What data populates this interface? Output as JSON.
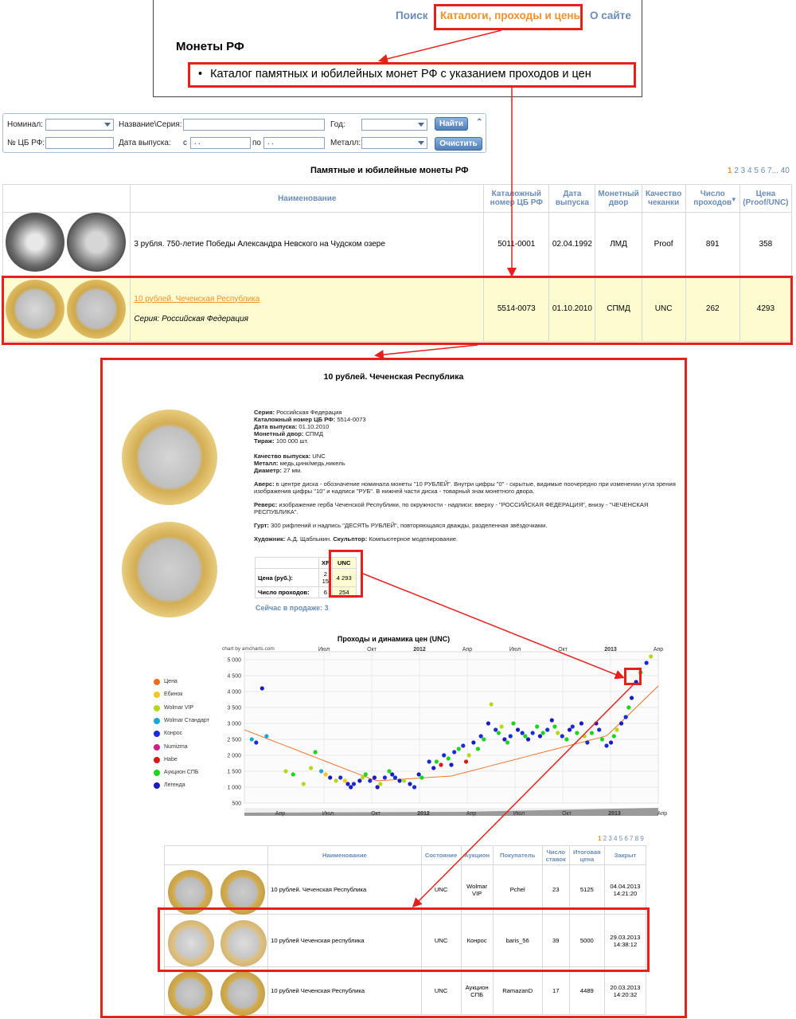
{
  "nav": {
    "search": "Поиск",
    "catalogs": "Каталоги, проходы и цены",
    "about": "О сайте",
    "section_title": "Монеты РФ",
    "catalog_link": "Каталог памятных и юбилейных монет РФ с указанием проходов и цен"
  },
  "filters": {
    "nominal_label": "Номинал:",
    "name_label": "Название\\Серия:",
    "year_label": "Год:",
    "cbr_label": "№ ЦБ РФ:",
    "date_label": "Дата выпуска:",
    "from_label": "с",
    "to_label": "по",
    "metal_label": "Металл:",
    "date_placeholder": " .  .    ",
    "find_button": "Найти",
    "clear_button": "Очистить"
  },
  "list": {
    "title": "Памятные и юбилейные монеты РФ",
    "pager_current": "1",
    "pager_rest": "2 3 4 5 6 7...",
    "pager_last": "40",
    "headers": {
      "name": "Наименование",
      "catalog": "Каталожный номер ЦБ РФ",
      "date": "Дата выпуска",
      "mint": "Монетный двор",
      "quality": "Качество чеканки",
      "passes": "Число проходов",
      "price": "Цена (Proof/UNC)"
    },
    "rows": [
      {
        "name": "3 рубля. 750-летие Победы Александра Невского на Чудском озере",
        "series": "",
        "catalog": "5011-0001",
        "date": "02.04.1992",
        "mint": "ЛМД",
        "quality": "Proof",
        "passes": "891",
        "price": "358"
      },
      {
        "name": "10 рублей. Чеченская Республика",
        "series": "Серия: Российская Федерация",
        "catalog": "5514-0073",
        "date": "01.10.2010",
        "mint": "СПМД",
        "quality": "UNC",
        "passes": "262",
        "price": "4293"
      }
    ]
  },
  "detail": {
    "title": "10 рублей. Чеченская Республика",
    "series_label": "Серия:",
    "series": "Российская Федерация",
    "catalog_label": "Каталожный номер ЦБ РФ:",
    "catalog": "5514-0073",
    "date_label": "Дата выпуска:",
    "date": "01.10.2010",
    "mint_label": "Монетный двор:",
    "mint": "СПМД",
    "mintage_label": "Тираж:",
    "mintage": "100 000 шт.",
    "quality_label": "Качество выпуска:",
    "quality": "UNC",
    "metal_label": "Металл:",
    "metal": "медь,цинк/медь,никель",
    "diameter_label": "Диаметр:",
    "diameter": "27 мм.",
    "obverse_label": "Аверс:",
    "obverse": "в центре диска - обозначение номинала монеты \"10 РУБЛЕЙ\". Внутри цифры \"0\" - скрытые, видимые поочередно при изменении угла зрения изображения цифры \"10\" и надписи \"РУБ\". В нижней части диска - товарный знак монетного двора.",
    "reverse_label": "Реверс:",
    "reverse": "изображение герба Чеченской Республики, по окружности - надписи: вверху - \"РОССИЙСКАЯ ФЕДЕРАЦИЯ\", внизу - \"ЧЕЧЕНСКАЯ РЕСПУБЛИКА\".",
    "edge_label": "Гурт:",
    "edge": "300 рифлений и надпись \"ДЕСЯТЬ РУБЛЕЙ\", повторяющаяся дважды, разделенная звёздочками.",
    "artist_label": "Художник:",
    "artist": "А.Д. Щаблыкин.",
    "sculptor_label": "Скульптор:",
    "sculptor": "Компьютерное моделирование.",
    "price_table": {
      "col_xf": "XF",
      "col_unc": "UNC",
      "price_label": "Цена (руб.):",
      "price_xf": "2 15",
      "price_unc": "4 293",
      "passes_label": "Число проходов:",
      "passes_xf": "6",
      "passes_unc": "254"
    },
    "on_sale": "Сейчас в продаже: 3"
  },
  "chart_data": {
    "type": "scatter",
    "title": "Проходы и динамика цен (UNC)",
    "credit": "chart by amcharts.com",
    "x_ticks": [
      "Июл",
      "Окт",
      "2012",
      "Апр",
      "Июл",
      "Окт",
      "2013",
      "Апр"
    ],
    "scroll_ticks": [
      "Апр",
      "Июл",
      "Окт",
      "2012",
      "Апр",
      "Июл",
      "Окт",
      "2013",
      "Апр"
    ],
    "y_ticks": [
      "5 000",
      "4 500",
      "4 000",
      "3 500",
      "3 000",
      "2 500",
      "2 000",
      "1 500",
      "1 000",
      "500"
    ],
    "ylim": [
      500,
      5000
    ],
    "series": [
      {
        "name": "Цена",
        "color": "#f26a1b"
      },
      {
        "name": "Ебинок",
        "color": "#f2c81b"
      },
      {
        "name": "Wolmar VIP",
        "color": "#b9d61b"
      },
      {
        "name": "Wolmar Стандарт",
        "color": "#1ba6d6"
      },
      {
        "name": "Конрос",
        "color": "#1b2cd6"
      },
      {
        "name": "Numizma",
        "color": "#d61b8a"
      },
      {
        "name": "Habe",
        "color": "#d61b1b"
      },
      {
        "name": "Аукцион СПБ",
        "color": "#1bd61b"
      },
      {
        "name": "Легенда",
        "color": "#1b1bbf"
      }
    ],
    "points": [
      [
        0.05,
        2500,
        3
      ],
      [
        0.08,
        2400,
        4
      ],
      [
        0.12,
        4100,
        8
      ],
      [
        0.15,
        2600,
        3
      ],
      [
        0.28,
        1500,
        2
      ],
      [
        0.33,
        1400,
        7
      ],
      [
        0.4,
        1100,
        2
      ],
      [
        0.45,
        1600,
        2
      ],
      [
        0.48,
        2100,
        7
      ],
      [
        0.52,
        1500,
        3
      ],
      [
        0.55,
        1400,
        1
      ],
      [
        0.58,
        1300,
        8
      ],
      [
        0.62,
        1200,
        2
      ],
      [
        0.65,
        1300,
        4
      ],
      [
        0.68,
        1200,
        1
      ],
      [
        0.7,
        1100,
        8
      ],
      [
        0.72,
        1000,
        8
      ],
      [
        0.74,
        1100,
        4
      ],
      [
        0.78,
        1200,
        8
      ],
      [
        0.8,
        1300,
        2
      ],
      [
        0.82,
        1400,
        7
      ],
      [
        0.85,
        1200,
        4
      ],
      [
        0.88,
        1300,
        8
      ],
      [
        0.9,
        1000,
        8
      ],
      [
        0.92,
        1100,
        2
      ],
      [
        0.95,
        1300,
        4
      ],
      [
        0.98,
        1500,
        7
      ],
      [
        1.0,
        1400,
        8
      ],
      [
        1.02,
        1300,
        4
      ],
      [
        1.05,
        1200,
        8
      ],
      [
        1.08,
        1200,
        2
      ],
      [
        1.12,
        1100,
        8
      ],
      [
        1.15,
        1000,
        4
      ],
      [
        1.18,
        1400,
        8
      ],
      [
        1.2,
        1300,
        7
      ],
      [
        1.25,
        1800,
        4
      ],
      [
        1.28,
        1600,
        8
      ],
      [
        1.3,
        1800,
        7
      ],
      [
        1.33,
        1700,
        6
      ],
      [
        1.35,
        2000,
        4
      ],
      [
        1.38,
        1900,
        7
      ],
      [
        1.4,
        1700,
        8
      ],
      [
        1.42,
        2100,
        4
      ],
      [
        1.45,
        2200,
        7
      ],
      [
        1.48,
        2300,
        4
      ],
      [
        1.5,
        1800,
        6
      ],
      [
        1.52,
        2000,
        2
      ],
      [
        1.55,
        2400,
        8
      ],
      [
        1.58,
        2200,
        7
      ],
      [
        1.6,
        2600,
        4
      ],
      [
        1.62,
        2500,
        7
      ],
      [
        1.65,
        3000,
        8
      ],
      [
        1.67,
        3600,
        2
      ],
      [
        1.7,
        2800,
        4
      ],
      [
        1.72,
        2700,
        7
      ],
      [
        1.74,
        2900,
        2
      ],
      [
        1.76,
        2500,
        8
      ],
      [
        1.78,
        2400,
        7
      ],
      [
        1.8,
        2600,
        4
      ],
      [
        1.82,
        3000,
        7
      ],
      [
        1.85,
        2800,
        8
      ],
      [
        1.88,
        2700,
        4
      ],
      [
        1.9,
        2600,
        7
      ],
      [
        1.92,
        2500,
        8
      ],
      [
        1.95,
        2700,
        4
      ],
      [
        1.98,
        2900,
        7
      ],
      [
        2.0,
        2600,
        8
      ],
      [
        2.02,
        2700,
        7
      ],
      [
        2.05,
        2800,
        4
      ],
      [
        2.08,
        3100,
        8
      ],
      [
        2.1,
        2900,
        7
      ],
      [
        2.12,
        2700,
        2
      ],
      [
        2.15,
        2600,
        4
      ],
      [
        2.18,
        2500,
        7
      ],
      [
        2.2,
        2800,
        8
      ],
      [
        2.22,
        2900,
        4
      ],
      [
        2.25,
        2700,
        7
      ],
      [
        2.28,
        3000,
        8
      ],
      [
        2.3,
        2600,
        2
      ],
      [
        2.32,
        2400,
        4
      ],
      [
        2.35,
        2700,
        7
      ],
      [
        2.38,
        3000,
        8
      ],
      [
        2.4,
        2800,
        4
      ],
      [
        2.42,
        2500,
        7
      ],
      [
        2.45,
        2300,
        4
      ],
      [
        2.48,
        2400,
        8
      ],
      [
        2.5,
        2600,
        7
      ],
      [
        2.52,
        2800,
        2
      ],
      [
        2.55,
        3000,
        8
      ],
      [
        2.58,
        3200,
        4
      ],
      [
        2.6,
        3500,
        7
      ],
      [
        2.62,
        3800,
        8
      ],
      [
        2.65,
        4300,
        8
      ],
      [
        2.68,
        4600,
        7
      ],
      [
        2.72,
        4900,
        4
      ],
      [
        2.75,
        5100,
        2
      ]
    ]
  },
  "sales": {
    "pager_current": "1",
    "pager_rest": "2 3 4 5 6 7 8 9",
    "headers": {
      "name": "Наименование",
      "state": "Состояние",
      "auction": "Аукцион",
      "buyer": "Покупатель",
      "bids": "Число ставок",
      "final": "Итоговая цена",
      "closed": "Закрыт"
    },
    "rows": [
      {
        "name": "10 рублей. Чеченская Республика",
        "state": "UNC",
        "auction": "Wolmar VIP",
        "buyer": "Pchel",
        "bids": "23",
        "final": "5125",
        "closed": "04.04.2013 14:21:20"
      },
      {
        "name": "10 рублей Чеченская республика",
        "state": "UNC",
        "auction": "Конрос",
        "buyer": "baris_56",
        "bids": "39",
        "final": "5000",
        "closed": "29.03.2013 14:38:12"
      },
      {
        "name": "10 рублей Чеченская Республика",
        "state": "UNC",
        "auction": "Аукцион СПБ",
        "buyer": "RamazanD",
        "bids": "17",
        "final": "4489",
        "closed": "20.03.2013 14:20:32"
      }
    ]
  }
}
